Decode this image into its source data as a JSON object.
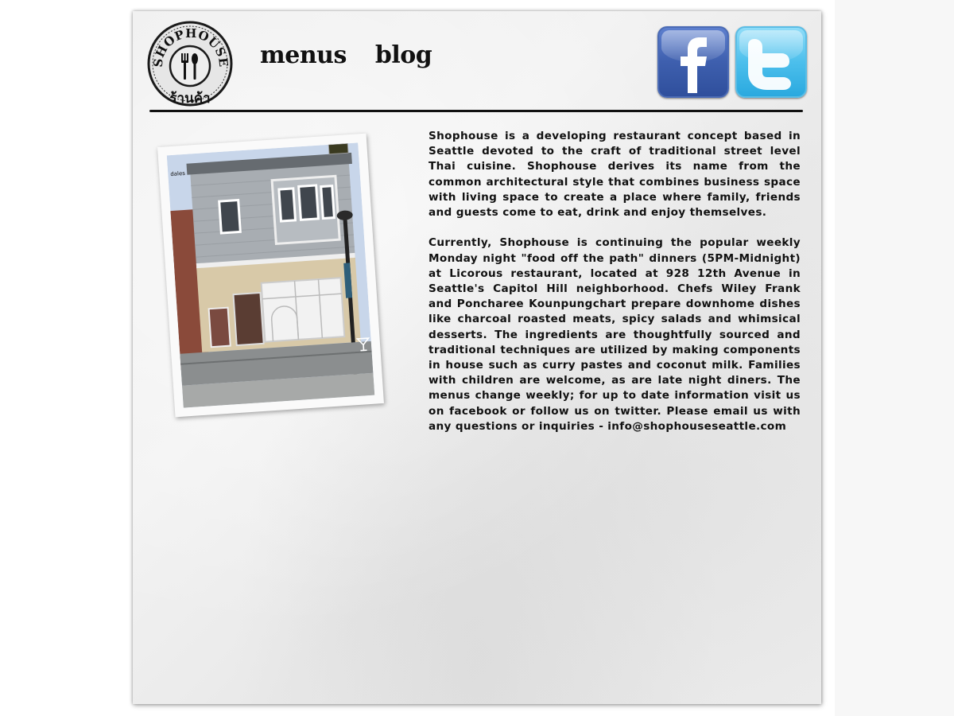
{
  "brand": {
    "logo_text": "SHOPHOUSE",
    "logo_thai": "ร้านค้า",
    "logo_icon": "fork-spoon-icon"
  },
  "nav": {
    "items": [
      {
        "label": "menus"
      },
      {
        "label": "blog"
      }
    ]
  },
  "social": {
    "facebook_icon": "facebook-icon",
    "twitter_icon": "twitter-icon",
    "facebook_color": "#3b5998",
    "twitter_color": "#4cbfec"
  },
  "photo": {
    "corner_label": "dales",
    "bottom_icon": "cocktail-glass-icon"
  },
  "content": {
    "paragraphs": [
      "Shophouse is a developing restaurant concept based in Seattle devoted to the craft of traditional street level Thai cuisine. Shophouse derives its name from the common architectural style that combines business space with living space to create a place where family, friends and guests come to eat, drink and enjoy themselves.",
      "Currently, Shophouse is continuing the popular weekly Monday night \"food off the path\" dinners (5PM-Midnight) at Licorous restaurant, located at 928 12th Avenue in Seattle's Capitol Hill neighborhood. Chefs Wiley Frank and Poncharee Kounpungchart prepare downhome dishes like charcoal roasted meats, spicy salads and whimsical desserts. The ingredients are thoughtfully sourced and traditional techniques are utilized by making components in house such as curry pastes and coconut milk. Families with children are welcome, as are late night diners. The menus change weekly; for up to date information visit us on facebook or follow us on twitter. Please email us with any questions or inquiries - info@shophouseseattle.com"
    ]
  }
}
